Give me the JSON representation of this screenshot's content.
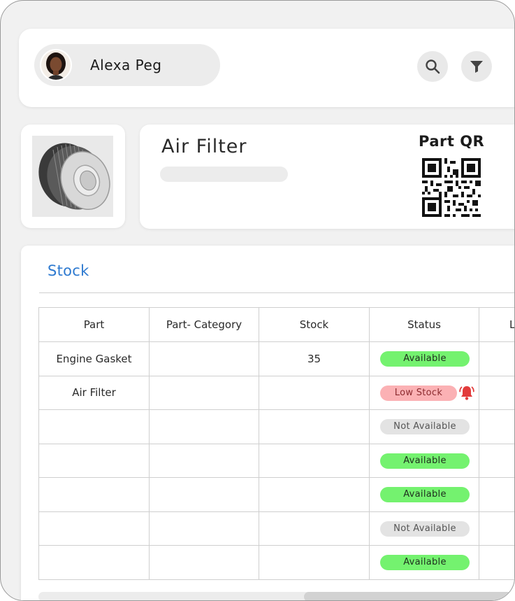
{
  "user": {
    "name": "Alexa Peg"
  },
  "icons": {
    "search": "search-icon",
    "filter": "filter-icon",
    "alarm": "alarm-bell-icon"
  },
  "part": {
    "title": "Air Filter",
    "qr_title": "Part QR"
  },
  "stock": {
    "title": "Stock",
    "columns": [
      "Part",
      "Part- Category",
      "Stock",
      "Status",
      "L"
    ],
    "rows": [
      {
        "part": "Engine Gasket",
        "category": "",
        "stock": "35",
        "status": "Available"
      },
      {
        "part": "Air Filter",
        "category": "",
        "stock": "",
        "status": "Low Stock"
      },
      {
        "part": "",
        "category": "",
        "stock": "",
        "status": "Not Available"
      },
      {
        "part": "",
        "category": "",
        "stock": "",
        "status": "Available"
      },
      {
        "part": "",
        "category": "",
        "stock": "",
        "status": "Available"
      },
      {
        "part": "",
        "category": "",
        "stock": "",
        "status": "Not Available"
      },
      {
        "part": "",
        "category": "",
        "stock": "",
        "status": "Available"
      }
    ]
  },
  "colors": {
    "accent": "#2e7ad0",
    "available": "#74f26f",
    "low_stock": "#fbb1b4",
    "not_available": "#e3e3e3",
    "alarm": "#e23b3b"
  }
}
